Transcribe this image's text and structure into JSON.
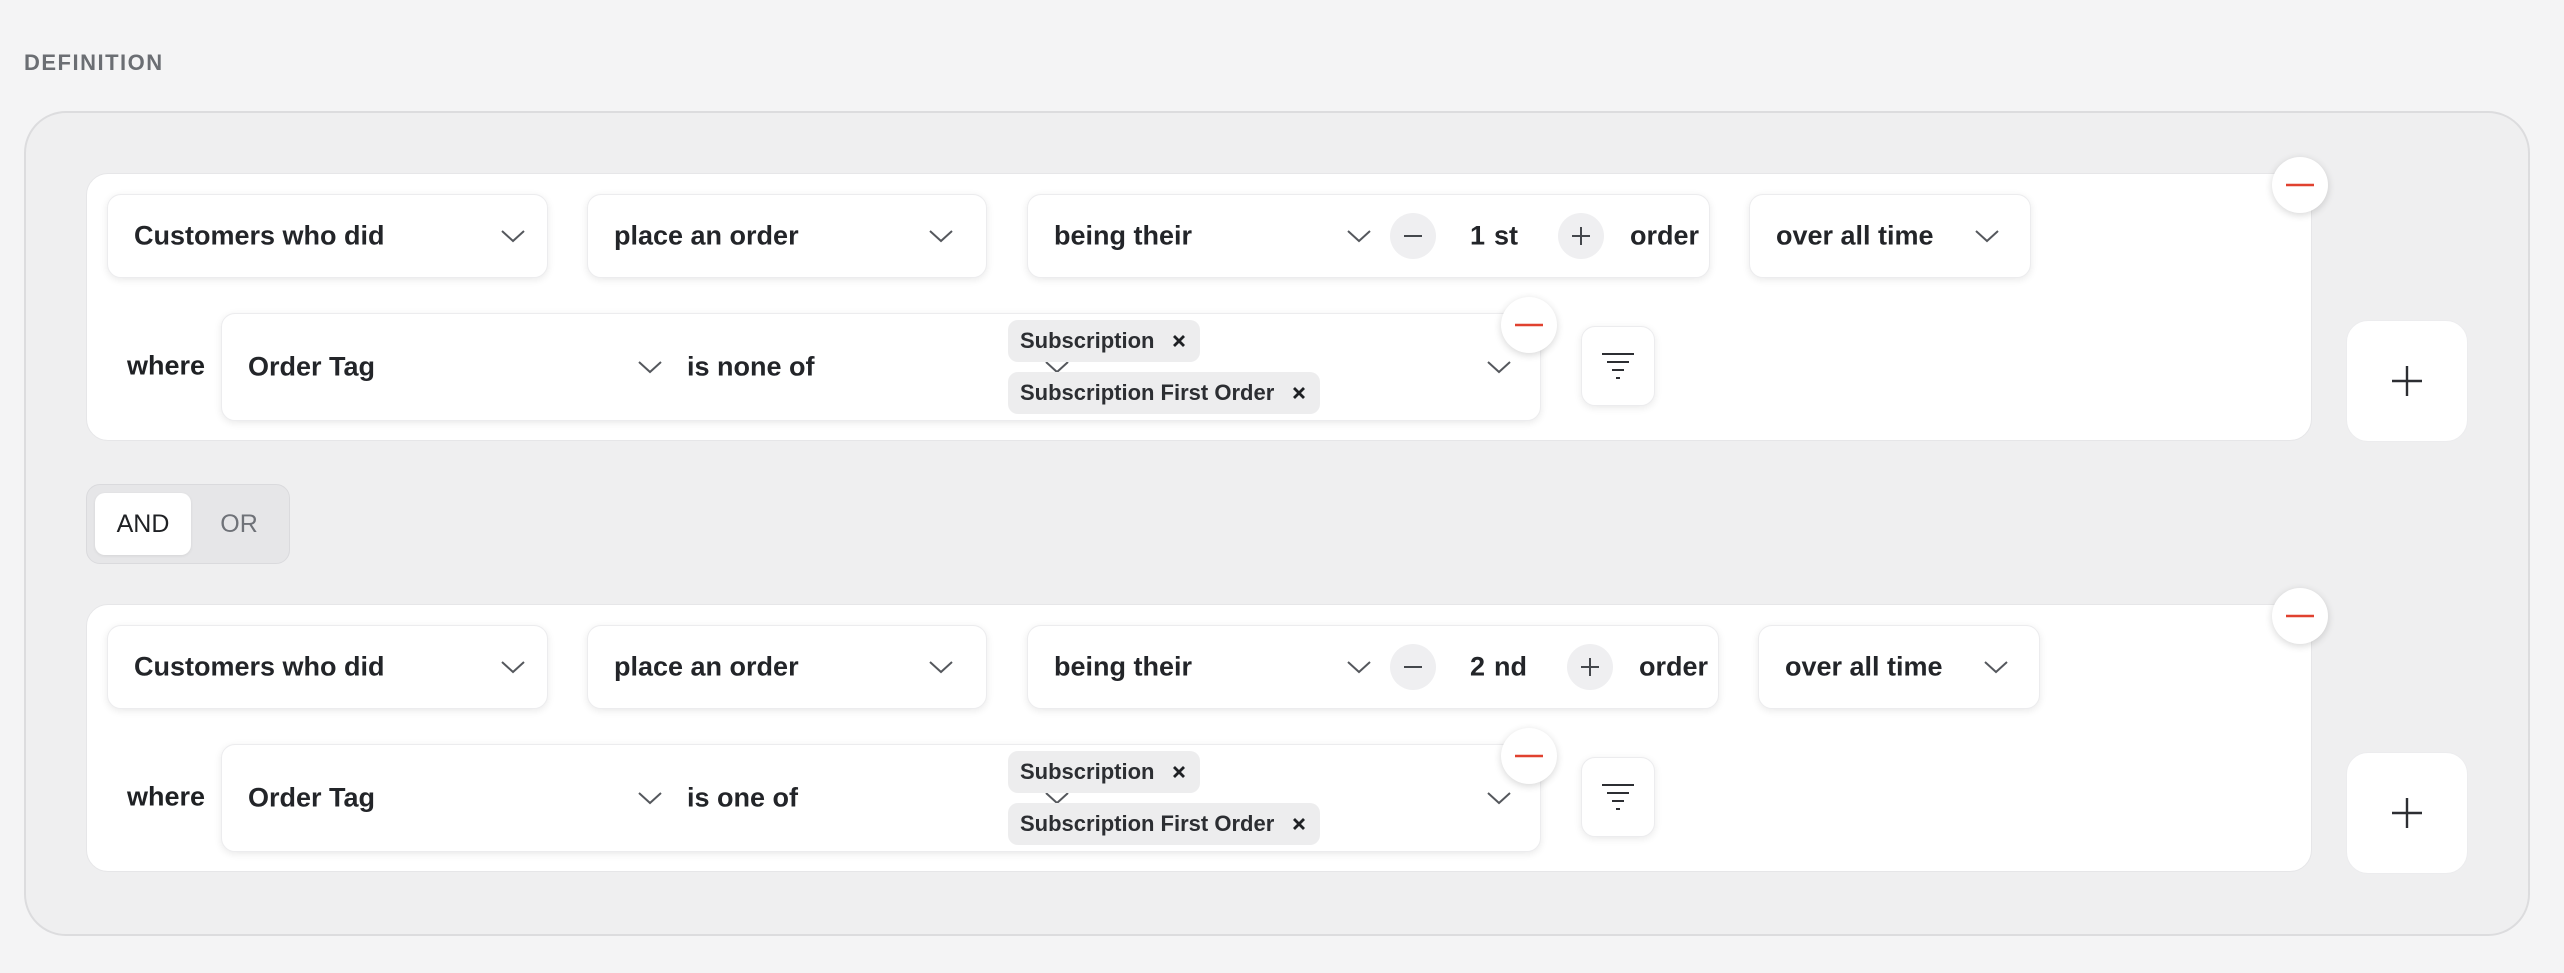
{
  "section_label": "DEFINITION",
  "groups": [
    {
      "who": "Customers who did",
      "action": "place an order",
      "being": "being their",
      "count": "1",
      "suffix": "st",
      "order_word": "order",
      "period": "over all time",
      "where": "where",
      "property": "Order Tag",
      "operator": "is none of",
      "tags": [
        "Subscription",
        "Subscription First Order"
      ]
    },
    {
      "who": "Customers who did",
      "action": "place an order",
      "being": "being their",
      "count": "2",
      "suffix": "nd",
      "order_word": "order",
      "period": "over all time",
      "where": "where",
      "property": "Order Tag",
      "operator": "is one of",
      "tags": [
        "Subscription",
        "Subscription First Order"
      ]
    }
  ],
  "logic_toggle": {
    "options": [
      "AND",
      "OR"
    ],
    "selected": "AND"
  },
  "icons": {
    "remove": "minus-circle-icon",
    "add": "plus-icon",
    "filter": "filter-icon",
    "dropdown": "chevron-down-icon",
    "tag_remove": "close-icon"
  },
  "colors": {
    "remove_accent": "#e0412f",
    "panel_bg": "#efeff0",
    "card_bg": "#ffffff"
  }
}
